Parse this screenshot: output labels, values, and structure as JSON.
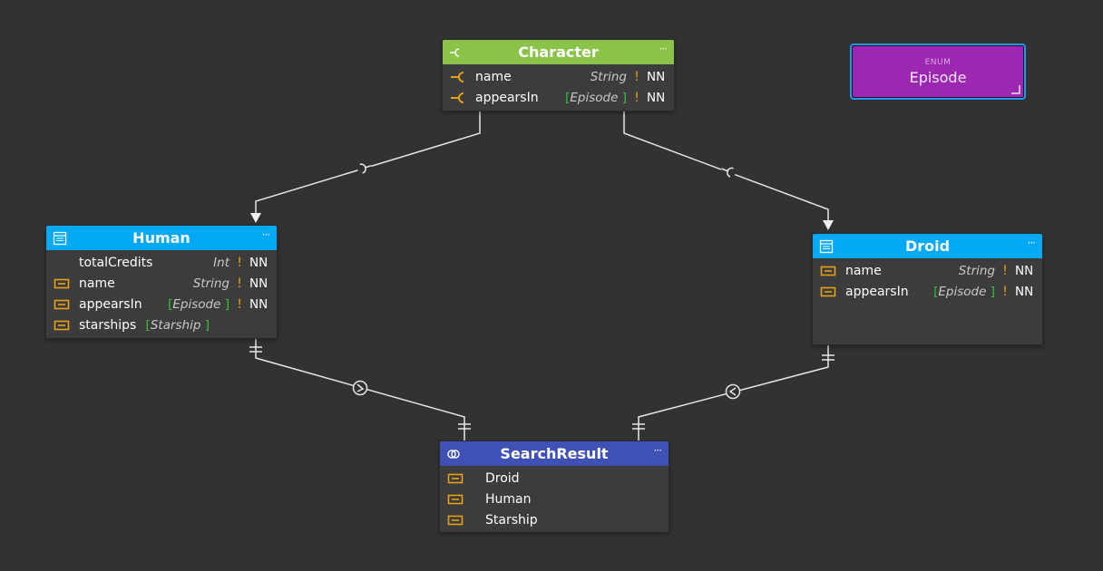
{
  "colors": {
    "canvas": "#323232",
    "interface_header": "#8bc34a",
    "type_header": "#03a9f4",
    "union_header": "#3f51b5",
    "enum_fill": "#9c27b0",
    "selection": "#2196f3",
    "field_icon": "#e6a017",
    "list_bracket": "#38c038",
    "link": "#e0e0e0"
  },
  "nodes": {
    "character": {
      "kind": "interface",
      "icon": "interface-icon",
      "title": "Character",
      "more": "···",
      "fields": [
        {
          "name": "name",
          "type": "String",
          "list": false,
          "required": "!",
          "nn": "NN"
        },
        {
          "name": "appearsIn",
          "type": "Episode",
          "list": true,
          "required": "!",
          "nn": "NN"
        }
      ]
    },
    "human": {
      "kind": "type",
      "icon": "object-type-icon",
      "title": "Human",
      "more": "···",
      "fields": [
        {
          "name": "totalCredits",
          "type": "Int",
          "list": false,
          "required": "!",
          "nn": "NN",
          "inherited": false
        },
        {
          "name": "name",
          "type": "String",
          "list": false,
          "required": "!",
          "nn": "NN",
          "inherited": true
        },
        {
          "name": "appearsIn",
          "type": "Episode",
          "list": true,
          "required": "!",
          "nn": "NN",
          "inherited": true
        },
        {
          "name": "starships",
          "type": "Starship",
          "list": true,
          "required": "",
          "nn": "",
          "inherited": true
        }
      ]
    },
    "droid": {
      "kind": "type",
      "icon": "object-type-icon",
      "title": "Droid",
      "more": "···",
      "fields": [
        {
          "name": "name",
          "type": "String",
          "list": false,
          "required": "!",
          "nn": "NN"
        },
        {
          "name": "appearsIn",
          "type": "Episode",
          "list": true,
          "required": "!",
          "nn": "NN"
        }
      ]
    },
    "search_result": {
      "kind": "union",
      "icon": "union-icon",
      "title": "SearchResult",
      "more": "···",
      "members": [
        "Droid",
        "Human",
        "Starship"
      ]
    },
    "episode": {
      "kind_label": "ENUM",
      "title": "Episode",
      "selected": true
    }
  },
  "links": [
    {
      "from": "character",
      "to": "human",
      "type": "implements",
      "marker": "interface-socket"
    },
    {
      "from": "character",
      "to": "droid",
      "type": "implements",
      "marker": "interface-socket"
    },
    {
      "from": "human",
      "to": "search_result",
      "type": "union-member",
      "marker": "one-to-one"
    },
    {
      "from": "droid",
      "to": "search_result",
      "type": "union-member",
      "marker": "one-to-one"
    }
  ],
  "brackets": {
    "open": "[",
    "close": "]"
  }
}
